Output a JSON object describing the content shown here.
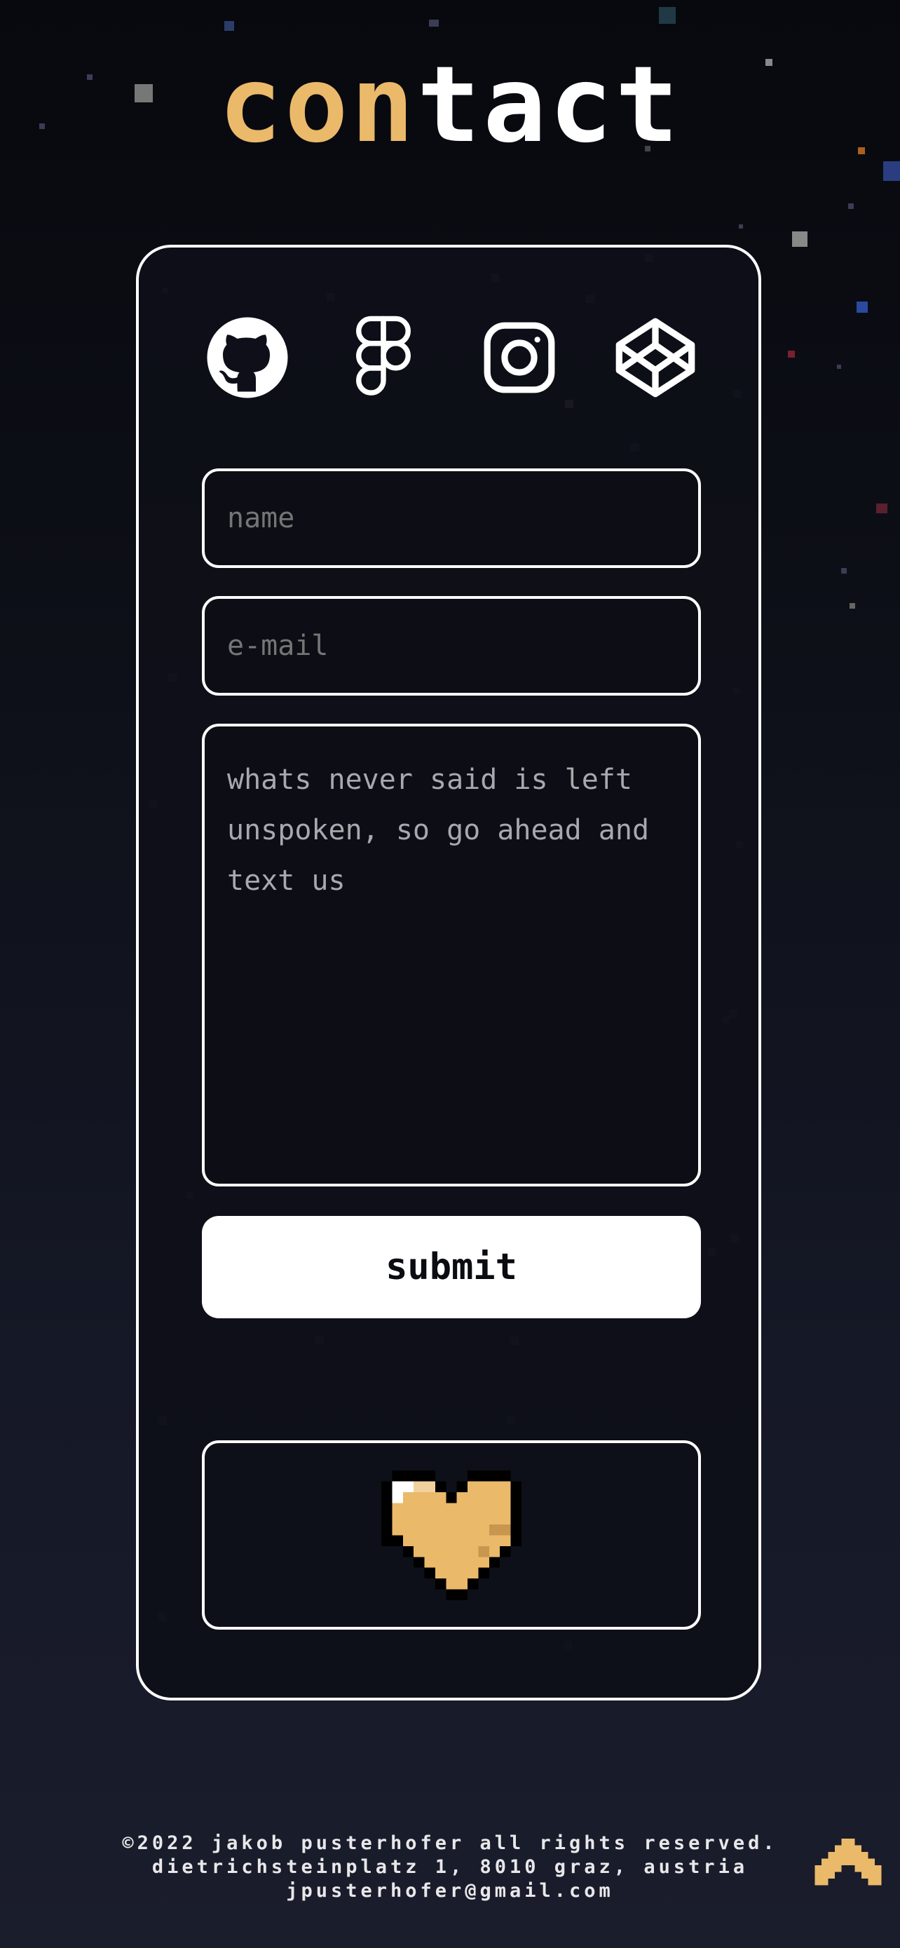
{
  "page": {
    "title_accent": "con",
    "title_rest": "tact"
  },
  "socials": [
    {
      "name": "github",
      "icon": "github-icon"
    },
    {
      "name": "figma",
      "icon": "figma-icon"
    },
    {
      "name": "instagram",
      "icon": "instagram-icon"
    },
    {
      "name": "codepen",
      "icon": "codepen-icon"
    }
  ],
  "form": {
    "name_placeholder": "name",
    "email_placeholder": "e-mail",
    "message_placeholder": "whats never said is left unspoken, so go ahead and text us",
    "submit_label": "submit"
  },
  "heart": {
    "icon": "pixel-heart-icon",
    "color": "#eab96a"
  },
  "footer": {
    "copyright": "©2022 jakob pusterhofer all rights reserved.",
    "address": "dietrichsteinplatz 1, 8010 graz, austria",
    "email": "jpusterhofer@gmail.com"
  },
  "colors": {
    "accent": "#eab96a",
    "background": "#0d0f17",
    "foreground": "#ffffff"
  },
  "back_to_top": {
    "icon": "chevron-up-icon"
  }
}
